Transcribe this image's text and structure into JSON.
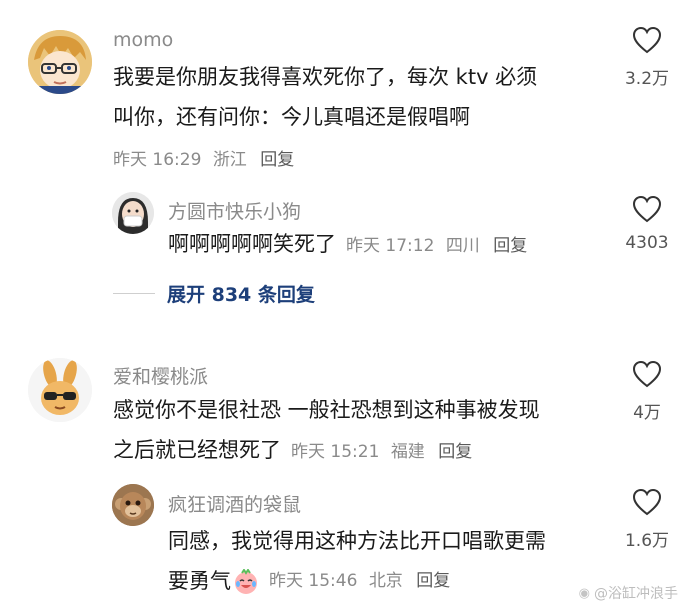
{
  "comments": [
    {
      "username": "momo",
      "text_line1": "我要是你朋友我得喜欢死你了，每次 ktv 必须",
      "text_line2": "叫你，还有问你：今儿真唱还是假唱啊",
      "time": "昨天 16:29",
      "location": "浙江",
      "reply_label": "回复",
      "likes": "3.2万",
      "avatar_icon": "anime-boy-avatar-icon",
      "replies": [
        {
          "username": "方圆市快乐小狗",
          "text": "啊啊啊啊啊笑死了",
          "time": "昨天 17:12",
          "location": "四川",
          "reply_label": "回复",
          "likes": "4303",
          "avatar_icon": "girl-mask-avatar-icon"
        }
      ],
      "expand_label": "展开 834 条回复"
    },
    {
      "username": "爱和樱桃派",
      "text_line1": "感觉你不是很社恐 一般社恐想到这种事被发现",
      "text_line2": "之后就已经想死了",
      "time": "昨天 15:21",
      "location": "福建",
      "reply_label": "回复",
      "likes": "4万",
      "avatar_icon": "bunny-sunglasses-avatar-icon",
      "replies": [
        {
          "username": "疯狂调酒的袋鼠",
          "text_line1": "同感，我觉得用这种方法比开口唱歌更需",
          "text_line2": "要勇气",
          "emoji": "crying-laughing-emoji",
          "time": "昨天 15:46",
          "location": "北京",
          "reply_label": "回复",
          "likes": "1.6万",
          "avatar_icon": "monkey-avatar-icon"
        }
      ]
    }
  ],
  "watermark": {
    "text": "@浴缸冲浪手",
    "icon": "weibo-icon"
  },
  "colors": {
    "meta": "#8a8a8a",
    "expand": "#1d3f7a",
    "text": "#1a1a1a"
  }
}
